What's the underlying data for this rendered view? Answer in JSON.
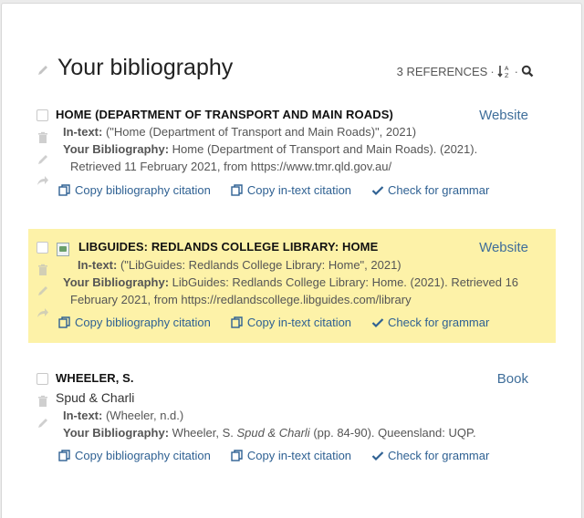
{
  "header": {
    "title": "Your bibliography",
    "ref_count": "3 REFERENCES",
    "sep": "·",
    "sort_glyph_top": "A",
    "sort_glyph_bottom": "Z",
    "icons": [
      "pencil-icon",
      "sort-icon",
      "search-icon"
    ]
  },
  "entries": [
    {
      "title": "HOME (DEPARTMENT OF TRANSPORT AND MAIN ROADS)",
      "type": "Website",
      "intext_label": "In-text:",
      "intext": "(\"Home (Department of Transport and Main Roads)\", 2021)",
      "bib_label": "Your Bibliography:",
      "bib_line1": "Home (Department of Transport and Main Roads). (2021).",
      "bib_line2": "Retrieved 11 February 2021, from https://www.tmr.qld.gov.au/",
      "actions": [
        "Copy bibliography citation",
        "Copy in-text citation",
        "Check for grammar"
      ]
    },
    {
      "title": "LIBGUIDES: REDLANDS COLLEGE LIBRARY: HOME",
      "type": "Website",
      "intext_label": "In-text:",
      "intext": "(\"LibGuides: Redlands College Library: Home\", 2021)",
      "bib_label": "Your Bibliography:",
      "bib_line1": "LibGuides: Redlands College Library: Home. (2021). Retrieved 16",
      "bib_line2": "February 2021, from https://redlandscollege.libguides.com/library",
      "highlight_color": "#fdf2a8",
      "actions": [
        "Copy bibliography citation",
        "Copy in-text citation",
        "Check for grammar"
      ]
    },
    {
      "title": "WHEELER, S.",
      "type": "Book",
      "subtitle": "Spud & Charli",
      "intext_label": "In-text:",
      "intext": "(Wheeler, n.d.)",
      "bib_label": "Your Bibliography:",
      "bib_pre": "Wheeler, S. ",
      "bib_italic": "Spud & Charli",
      "bib_post_pages": " (pp. 84-90",
      "bib_post_rest": "). Queensland: UQP.",
      "actions": [
        "Copy bibliography citation",
        "Copy in-text citation",
        "Check for grammar"
      ]
    }
  ],
  "colors": {
    "link": "#2f6193",
    "type_label": "#3f6e9a",
    "highlight": "#fdf2a8"
  }
}
